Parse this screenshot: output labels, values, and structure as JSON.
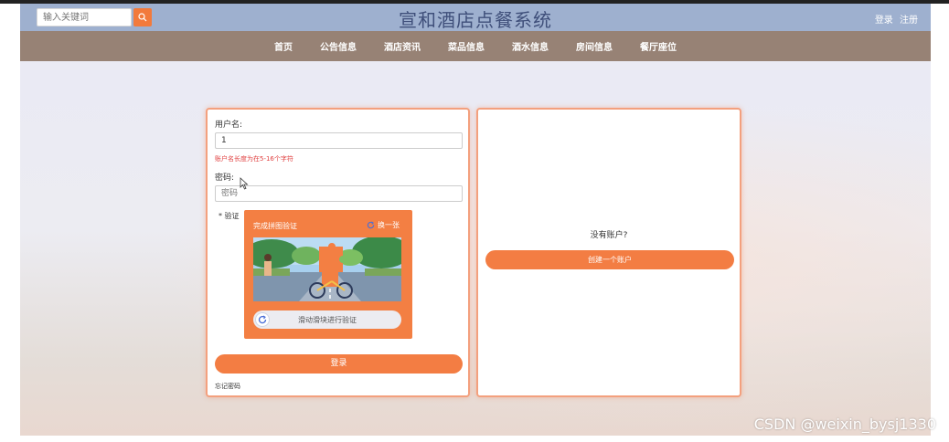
{
  "header": {
    "title": "宣和酒店点餐系统",
    "search_placeholder": "输入关键词",
    "login_label": "登录",
    "register_label": "注册"
  },
  "nav": {
    "items": [
      "首页",
      "公告信息",
      "酒店资讯",
      "菜品信息",
      "酒水信息",
      "房间信息",
      "餐厅座位"
    ]
  },
  "login": {
    "username_label": "用户名:",
    "username_value": "1",
    "username_error": "账户名长度为在5-16个字符",
    "password_label": "密码:",
    "password_placeholder": "密码",
    "verify_label": "* 验证",
    "captcha_title": "完成拼图验证",
    "captcha_refresh": "换一张",
    "slider_text": "滑动滑块进行验证",
    "submit_label": "登录",
    "forgot_label": "忘记密码"
  },
  "register": {
    "no_account_text": "没有账户?",
    "create_label": "创建一个账户"
  },
  "watermark": "CSDN @weixin_bysj1330",
  "colors": {
    "accent": "#f37d43",
    "header_bg": "#9eb0cf",
    "nav_bg": "#978275",
    "error": "#e04040"
  }
}
